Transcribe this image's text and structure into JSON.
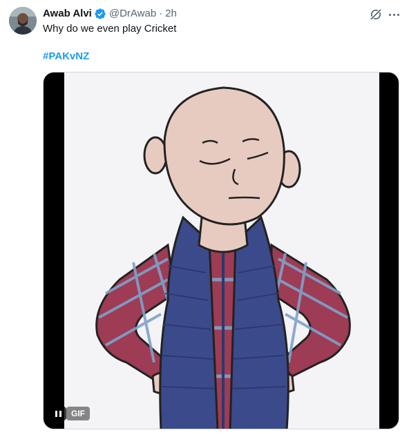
{
  "author": {
    "display_name": "Awab Alvi",
    "handle": "@DrAwab",
    "separator": "·",
    "time": "2h",
    "verified": true,
    "avatar_icon": "avatar-photo"
  },
  "tweet": {
    "text": "Why do we even play Cricket",
    "hashtag": "#PAKvNZ"
  },
  "media": {
    "type": "gif",
    "badge": "GIF",
    "content": "cartoon-bald-man-plaid-shirt-blue-vest"
  },
  "colors": {
    "accent": "#1d9bf0",
    "text": "#0f1419",
    "muted": "#536471",
    "vest": "#3b4a8a",
    "plaid": "#9e3b55",
    "skin": "#e8cbc0"
  },
  "icons": {
    "grok": "grok-icon",
    "more": "more-icon",
    "verified": "verified-badge-icon",
    "pause": "pause-icon"
  }
}
